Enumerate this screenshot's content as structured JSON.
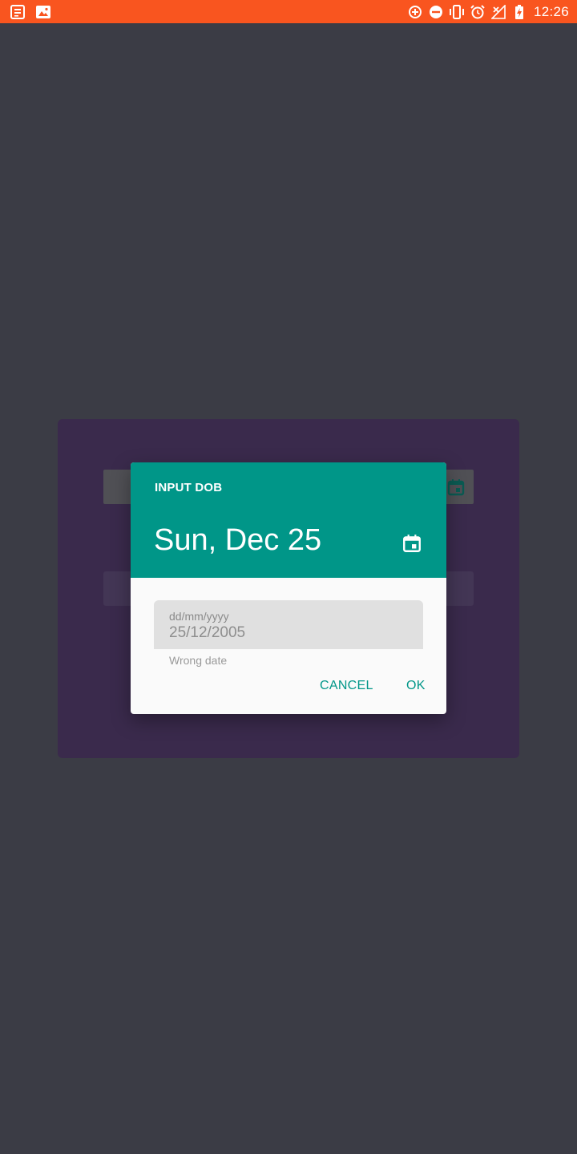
{
  "status_bar": {
    "time": "12:26",
    "background_color": "#f9551f",
    "left_icons": [
      "news-icon",
      "image-icon"
    ],
    "right_icons": [
      "data-saver-icon",
      "do-not-disturb-icon",
      "vibrate-icon",
      "alarm-icon",
      "no-signal-icon",
      "battery-charging-icon"
    ]
  },
  "dialog": {
    "title": "INPUT DOB",
    "selected_date": "Sun, Dec 25",
    "header_color": "#009688",
    "input": {
      "label": "dd/mm/yyyy",
      "value": "25/12/2005"
    },
    "error_text": "Wrong date",
    "cancel_label": "CANCEL",
    "ok_label": "OK"
  },
  "background": {
    "overlay_color": "#3b3c45",
    "card_color": "#3a2a4c"
  }
}
